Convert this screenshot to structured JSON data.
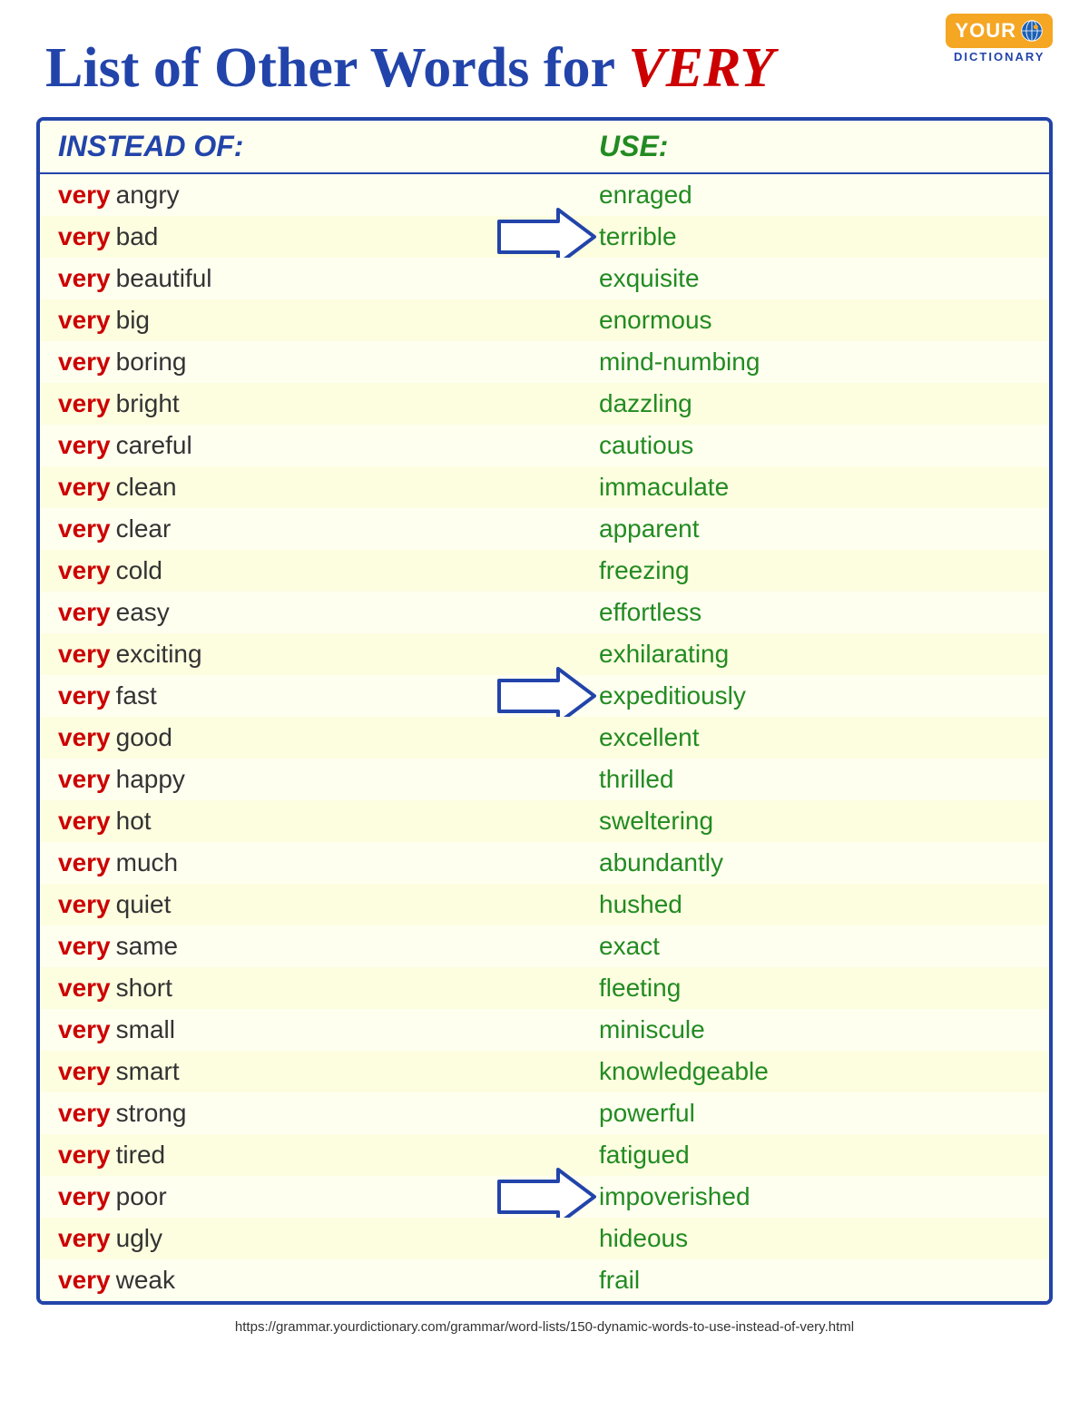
{
  "logo": {
    "your": "YOUR",
    "dictionary": "DICTIONARY"
  },
  "title": {
    "prefix": "List of Other Words for ",
    "highlight": "VERY"
  },
  "header": {
    "instead": "INSTEAD OF:",
    "use": "USE:"
  },
  "rows": [
    {
      "very": "very",
      "adj": "angry",
      "synonym": "enraged",
      "shaded": false,
      "arrow": false
    },
    {
      "very": "very",
      "adj": "bad",
      "synonym": "terrible",
      "shaded": true,
      "arrow": true
    },
    {
      "very": "very",
      "adj": "beautiful",
      "synonym": "exquisite",
      "shaded": false,
      "arrow": false
    },
    {
      "very": "very",
      "adj": "big",
      "synonym": "enormous",
      "shaded": true,
      "arrow": false
    },
    {
      "very": "very",
      "adj": "boring",
      "synonym": "mind-numbing",
      "shaded": false,
      "arrow": false
    },
    {
      "very": "very",
      "adj": "bright",
      "synonym": "dazzling",
      "shaded": true,
      "arrow": false
    },
    {
      "very": "very",
      "adj": "careful",
      "synonym": "cautious",
      "shaded": false,
      "arrow": false
    },
    {
      "very": "very",
      "adj": "clean",
      "synonym": "immaculate",
      "shaded": true,
      "arrow": false
    },
    {
      "very": "very",
      "adj": "clear",
      "synonym": "apparent",
      "shaded": false,
      "arrow": false
    },
    {
      "very": "very",
      "adj": "cold",
      "synonym": "freezing",
      "shaded": true,
      "arrow": false
    },
    {
      "very": "very",
      "adj": "easy",
      "synonym": "effortless",
      "shaded": false,
      "arrow": false
    },
    {
      "very": "very",
      "adj": "exciting",
      "synonym": "exhilarating",
      "shaded": true,
      "arrow": false
    },
    {
      "very": "very",
      "adj": "fast",
      "synonym": "expeditiously",
      "shaded": false,
      "arrow": true
    },
    {
      "very": "very",
      "adj": "good",
      "synonym": "excellent",
      "shaded": true,
      "arrow": false
    },
    {
      "very": "very",
      "adj": "happy",
      "synonym": "thrilled",
      "shaded": false,
      "arrow": false
    },
    {
      "very": "very",
      "adj": "hot",
      "synonym": "sweltering",
      "shaded": true,
      "arrow": false
    },
    {
      "very": "very",
      "adj": "much",
      "synonym": "abundantly",
      "shaded": false,
      "arrow": false
    },
    {
      "very": "very",
      "adj": "quiet",
      "synonym": "hushed",
      "shaded": true,
      "arrow": false
    },
    {
      "very": "very",
      "adj": "same",
      "synonym": "exact",
      "shaded": false,
      "arrow": false
    },
    {
      "very": "very",
      "adj": "short",
      "synonym": "fleeting",
      "shaded": true,
      "arrow": false
    },
    {
      "very": "very",
      "adj": "small",
      "synonym": "miniscule",
      "shaded": false,
      "arrow": false
    },
    {
      "very": "very",
      "adj": "smart",
      "synonym": "knowledgeable",
      "shaded": true,
      "arrow": false
    },
    {
      "very": "very",
      "adj": "strong",
      "synonym": "powerful",
      "shaded": false,
      "arrow": false
    },
    {
      "very": "very",
      "adj": "tired",
      "synonym": "fatigued",
      "shaded": true,
      "arrow": false
    },
    {
      "very": "very",
      "adj": "poor",
      "synonym": "impoverished",
      "shaded": false,
      "arrow": true
    },
    {
      "very": "very",
      "adj": "ugly",
      "synonym": "hideous",
      "shaded": true,
      "arrow": false
    },
    {
      "very": "very",
      "adj": "weak",
      "synonym": "frail",
      "shaded": false,
      "arrow": false
    }
  ],
  "footer": {
    "url": "https://grammar.yourdictionary.com/grammar/word-lists/150-dynamic-words-to-use-instead-of-very.html"
  }
}
